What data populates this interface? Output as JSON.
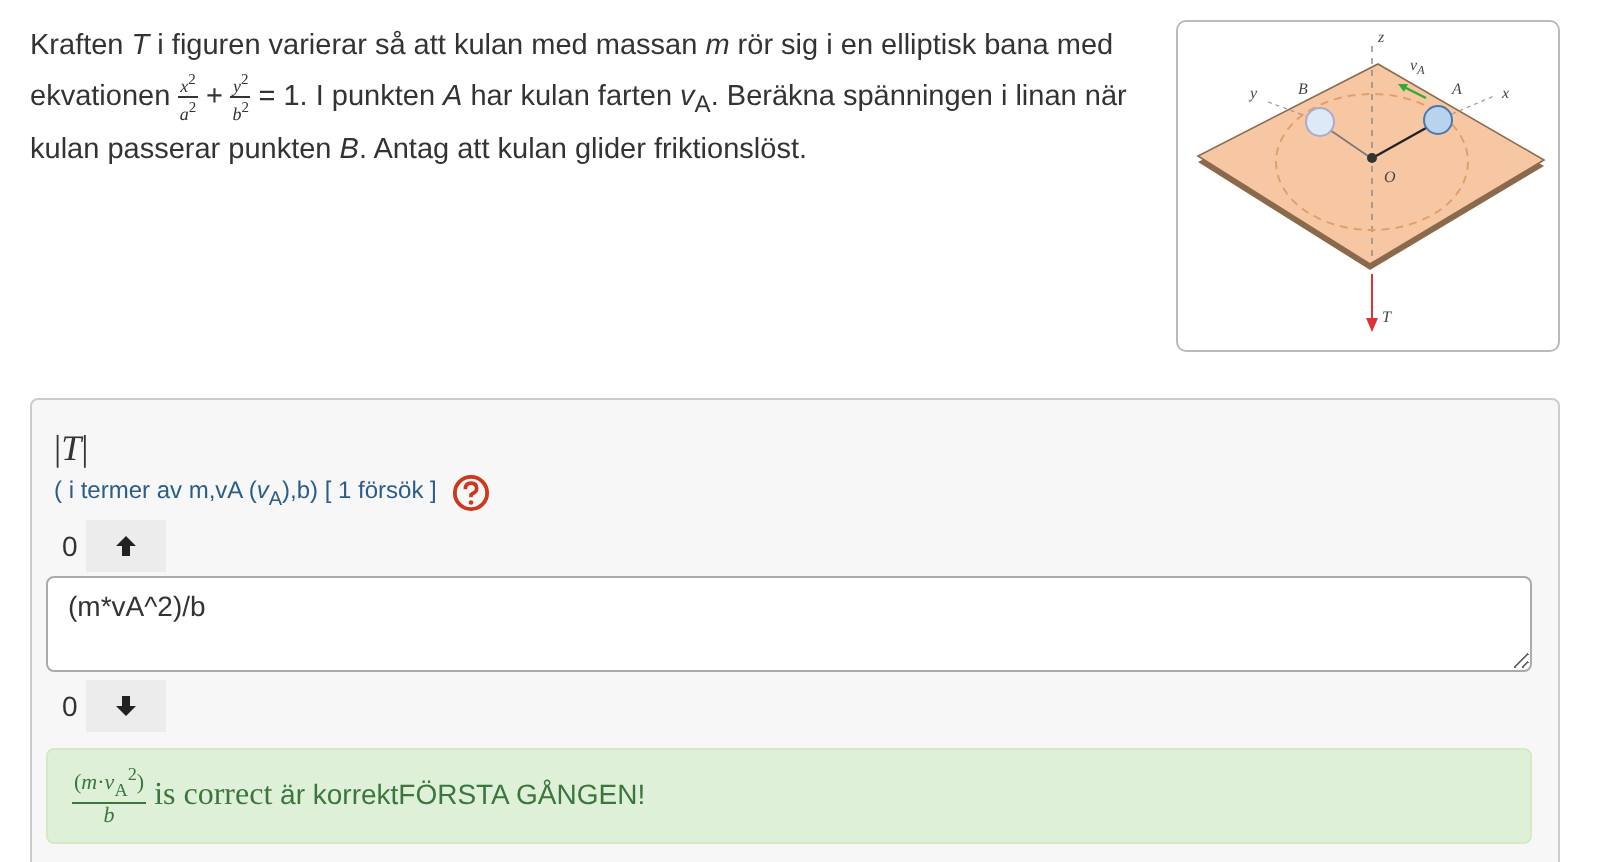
{
  "question": [
    {
      "kind": "text",
      "text": "Kraften *T* i figuren varierar så att kulan med massan *m* rör sig i en elliptisk bana med ekvationen "
    },
    {
      "kind": "frac",
      "num": "*x*$^{2}$",
      "den": "*a*$^{2}$"
    },
    {
      "kind": "text",
      "text": " + "
    },
    {
      "kind": "frac",
      "num": "*y*$^{2}$",
      "den": "*b*$^{2}$"
    },
    {
      "kind": "text",
      "text": " = 1. I punkten *A* har kulan farten *v*$_{A}$. Beräkna spänningen i linan när kulan passerar punkten *B*. Antag att kulan glider friktionslöst."
    }
  ],
  "figure": {
    "labels": [
      {
        "text": "z"
      },
      {
        "text": "y"
      },
      {
        "text": "B"
      },
      {
        "text": "v",
        "sub": "A"
      },
      {
        "text": "A"
      },
      {
        "text": "x"
      },
      {
        "text": "O"
      },
      {
        "text": "T"
      }
    ]
  },
  "answer": {
    "label": "|*T*|",
    "hint": "(   i termer av m,vA (*v*$_{A}$),b) [ 1   försök ]",
    "up_count": "0",
    "down_count": "0",
    "value": "(m*vA^2)/b",
    "feedback": {
      "num": "(*m*·*v*$_{A}$$^{2}$)",
      "den": "*b*",
      "correct": " is correct",
      "message": " är korrektFÖRSTA GÅNGEN!"
    }
  }
}
